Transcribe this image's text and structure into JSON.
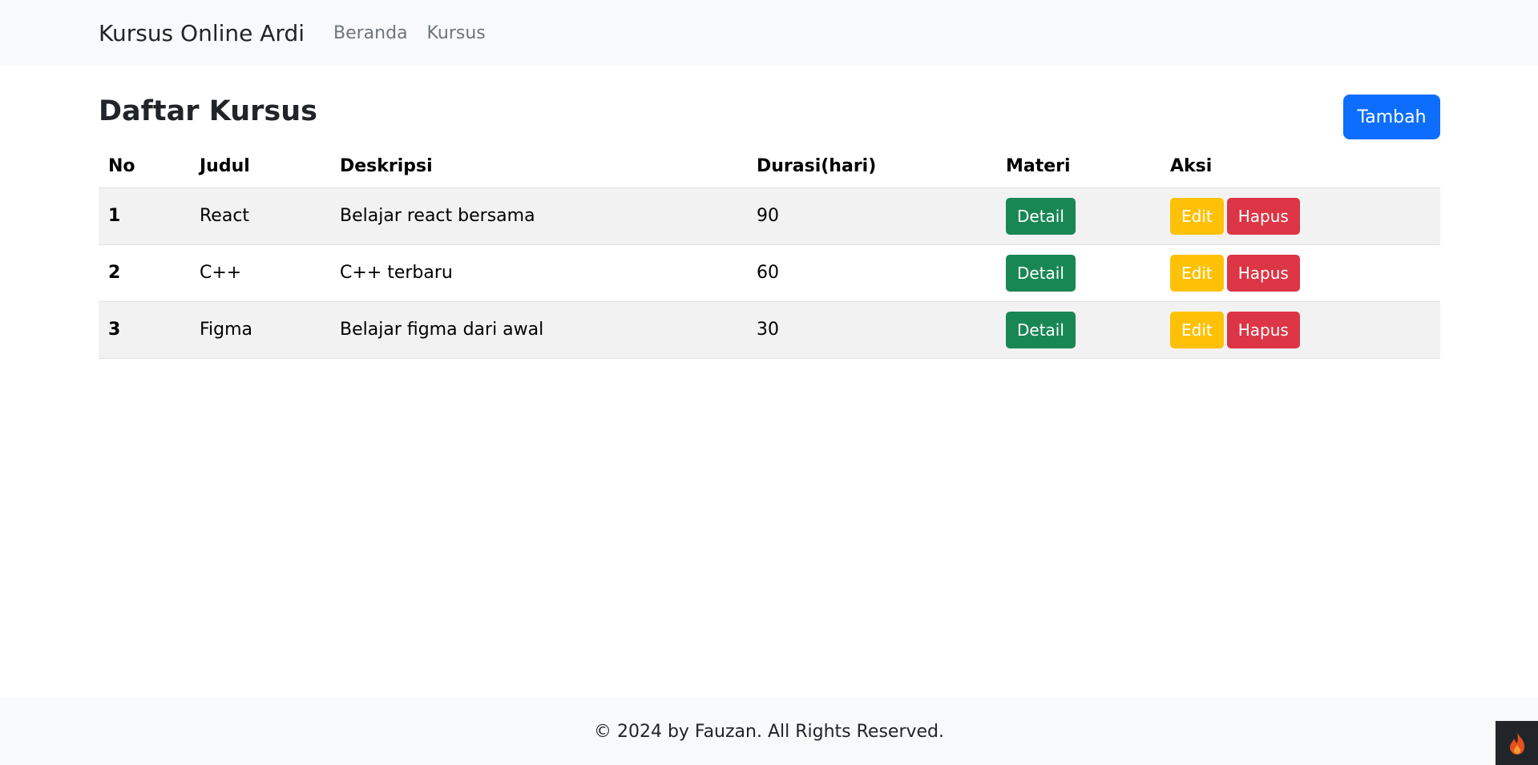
{
  "navbar": {
    "brand": "Kursus Online Ardi",
    "links": [
      "Beranda",
      "Kursus"
    ]
  },
  "page": {
    "title": "Daftar Kursus",
    "add_button": "Tambah"
  },
  "table": {
    "headers": [
      "No",
      "Judul",
      "Deskripsi",
      "Durasi(hari)",
      "Materi",
      "Aksi"
    ],
    "rows": [
      {
        "no": "1",
        "judul": "React",
        "deskripsi": "Belajar react bersama",
        "durasi": "90"
      },
      {
        "no": "2",
        "judul": "C++",
        "deskripsi": "C++ terbaru",
        "durasi": "60"
      },
      {
        "no": "3",
        "judul": "Figma",
        "deskripsi": "Belajar figma dari awal",
        "durasi": "30"
      }
    ],
    "detail_label": "Detail",
    "edit_label": "Edit",
    "delete_label": "Hapus"
  },
  "footer": {
    "text": "© 2024 by Fauzan. All Rights Reserved."
  },
  "icons": {
    "corner_widget": "flame-icon"
  },
  "colors": {
    "primary": "#0d6efd",
    "success": "#198754",
    "warning": "#ffc107",
    "danger": "#dc3545",
    "navbar_bg": "#f8f9fa"
  }
}
